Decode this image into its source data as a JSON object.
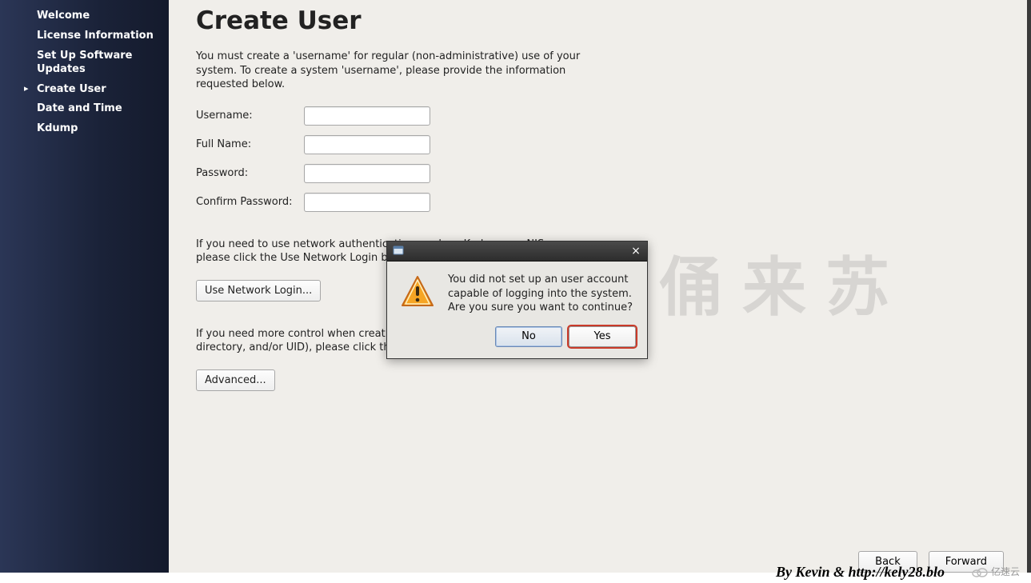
{
  "sidebar": {
    "items": [
      {
        "label": "Welcome"
      },
      {
        "label": "License Information"
      },
      {
        "label": "Set Up Software Updates"
      },
      {
        "label": "Create User"
      },
      {
        "label": "Date and Time"
      },
      {
        "label": "Kdump"
      }
    ],
    "activeIndex": 3
  },
  "main": {
    "title": "Create User",
    "intro": "You must create a 'username' for regular (non-administrative) use of your system.  To create a system 'username', please provide the information requested below.",
    "fields": {
      "username_label": "Username:",
      "username_value": "",
      "fullname_label": "Full Name:",
      "fullname_value": "",
      "password_label": "Password:",
      "password_value": "",
      "confirm_label": "Confirm Password:",
      "confirm_value": ""
    },
    "network_help": "If you need to use network authentication, such as Kerberos or NIS, please click the Use Network Login button.",
    "network_btn": "Use Network Login...",
    "advanced_help": "If you need more control when creating the user (specifying home directory, and/or UID), please click the Advanced button.",
    "advanced_btn": "Advanced...",
    "back_btn": "Back",
    "forward_btn": "Forward"
  },
  "dialog": {
    "message": "You did not set up an user account capable of logging into the system. Are you sure you want to continue?",
    "no_btn": "No",
    "yes_btn": "Yes"
  },
  "watermark_text": "兵马俑来苏",
  "byline": "By Kevin & http://kely28.blo",
  "logo_text": "亿速云"
}
